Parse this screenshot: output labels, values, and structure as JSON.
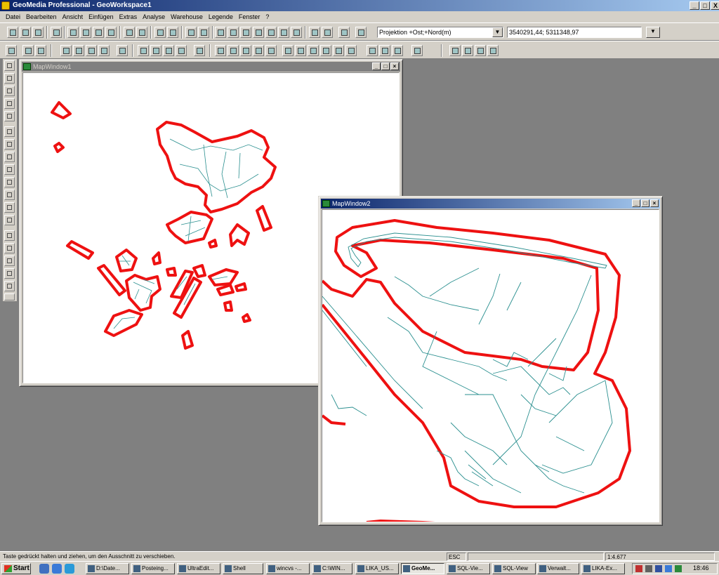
{
  "app": {
    "title": "GeoMedia Professional - GeoWorkspace1",
    "min": "_",
    "max": "□",
    "close": "X"
  },
  "menu": [
    "Datei",
    "Bearbeiten",
    "Ansicht",
    "Einfügen",
    "Extras",
    "Analyse",
    "Warehouse",
    "Legende",
    "Fenster",
    "?"
  ],
  "coordsystem": {
    "selected": "Projektion +Ost;+Nord(m)",
    "coordinates": "3540291,44; 5311348,97"
  },
  "windows": {
    "map1": {
      "title": "MapWindow1"
    },
    "map2": {
      "title": "MapWindow2"
    }
  },
  "colors": {
    "buffer": "#ee1111",
    "parcels": "#2a8f8f",
    "mdi_active": "#0a246a"
  },
  "status": {
    "hint": "Taste gedrückt halten und ziehen, um den Ausschnitt zu verschieben.",
    "key": "ESC",
    "scale": "1:4.677"
  },
  "taskbar": {
    "start": "Start",
    "tasks": [
      "D:\\Date...",
      "Posteing...",
      "UltraEdit...",
      "Shell",
      "wincvs -...",
      "C:\\WIN...",
      "LIKA_US...",
      "GeoMe...",
      "SQL-Vie...",
      "SQL-View",
      "Verwalt...",
      "LIKA-Ex..."
    ],
    "clock": "18:46"
  }
}
